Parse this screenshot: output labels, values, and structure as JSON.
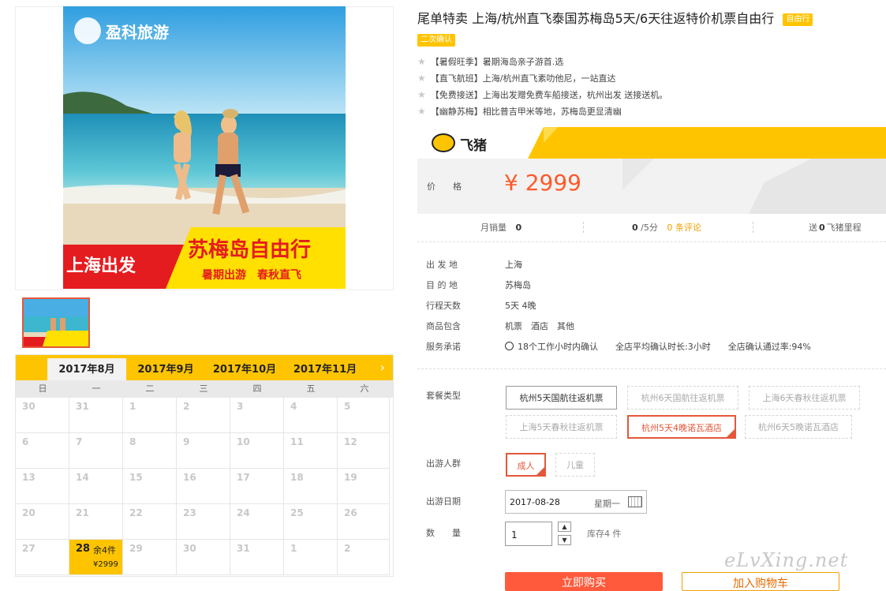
{
  "gallery": {
    "logo_text": "盈科旅游",
    "banner_red": "上海出发",
    "banner_title": "苏梅岛自由行",
    "banner_sub": "暑期出游　春秋直飞"
  },
  "calendar": {
    "months": [
      "2017年8月",
      "2017年9月",
      "2017年10月",
      "2017年11月"
    ],
    "weekdays": [
      "日",
      "一",
      "二",
      "三",
      "四",
      "五",
      "六"
    ],
    "weeks": [
      [
        "30",
        "31",
        "1",
        "2",
        "3",
        "4",
        "5"
      ],
      [
        "6",
        "7",
        "8",
        "9",
        "10",
        "11",
        "12"
      ],
      [
        "13",
        "14",
        "15",
        "16",
        "17",
        "18",
        "19"
      ],
      [
        "20",
        "21",
        "22",
        "23",
        "24",
        "25",
        "26"
      ],
      [
        "27",
        "28",
        "29",
        "30",
        "31",
        "1",
        "2"
      ]
    ],
    "selected_remaining": "余4件",
    "selected_price": "¥2999"
  },
  "product": {
    "title": "尾单特卖 上海/杭州直飞泰国苏梅岛5天/6天往返特价机票自由行",
    "tag1": "自由行",
    "tag2": "二次确认",
    "features": [
      "【暑假旺季】暑期海岛亲子游首.选",
      "【直飞航班】上海/杭州直飞素叻他尼，一站直达",
      "【免费接送】上海出发赠免费车船接送，杭州出发 送接送机。",
      "【幽静苏梅】相比普吉甲米等地，苏梅岛更显清幽"
    ],
    "brand": "飞猪",
    "price_label": "价　　格",
    "price": "¥ 2999",
    "stats": {
      "monthly_label": "月销量",
      "monthly_value": "0",
      "rating_value": "0",
      "rating_suffix": "/5分",
      "reviews": "0 条评论",
      "miles_prefix": "送",
      "miles_value": "0",
      "miles_suffix": "飞猪里程"
    },
    "info": [
      {
        "label": "出 发 地",
        "value": "上海"
      },
      {
        "label": "目 的 地",
        "value": "苏梅岛"
      },
      {
        "label": "行程天数",
        "value": "5天 4晚"
      },
      {
        "label": "商品包含",
        "value": "机票　酒店　其他"
      },
      {
        "label": "服务承诺",
        "value": "18个工作小时内确认　　全店平均确认时长:3小时　　全店确认通过率:94%"
      }
    ],
    "package_label": "套餐类型",
    "packages": [
      "杭州5天国航往返机票",
      "杭州6天国航往返机票",
      "上海6天春秋往返机票",
      "上海5天春秋往返机票",
      "杭州5天4晚诺瓦酒店",
      "杭州6天5晚诺瓦酒店"
    ],
    "group_label": "出游人群",
    "groups": [
      "成人",
      "儿童"
    ],
    "date_label": "出游日期",
    "date_value": "2017-08-28",
    "date_weekday": "星期一",
    "qty_label": "数　　量",
    "qty_value": "1",
    "stock": "库存4 件",
    "buy_now": "立即购买",
    "add_cart": "加入购物车",
    "watermark": "eLvXing.net"
  }
}
